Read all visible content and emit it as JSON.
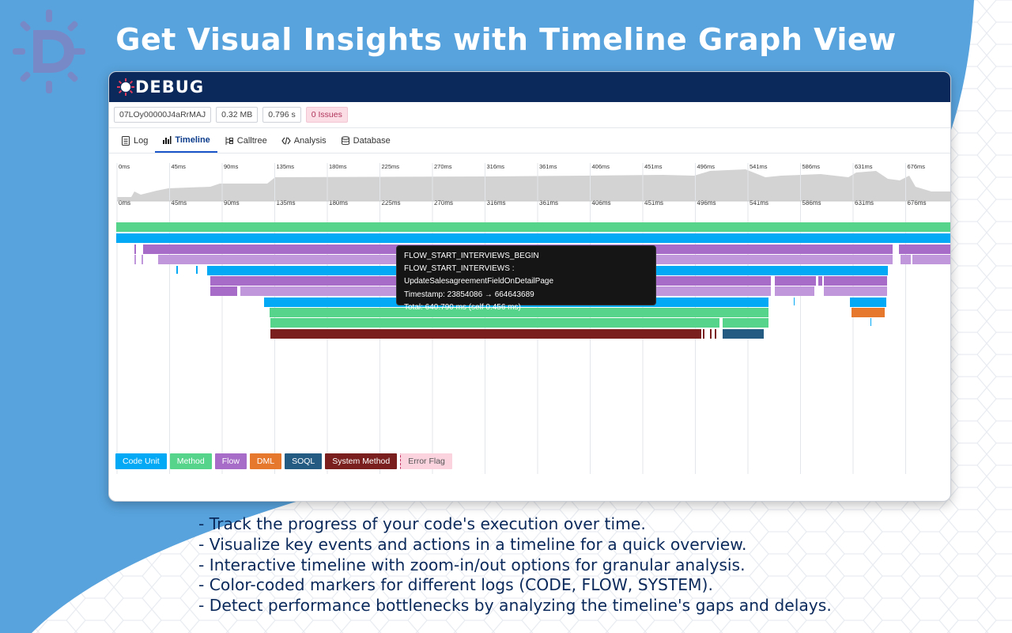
{
  "headline": "Get Visual Insights with Timeline Graph View",
  "brand": {
    "name": "DEBUG"
  },
  "info": {
    "log_id": "07LOy00000J4aRrMAJ",
    "size": "0.32 MB",
    "duration": "0.796 s",
    "issues": "0 Issues"
  },
  "tabs": [
    {
      "label": "Log",
      "icon": "log-icon",
      "active": false
    },
    {
      "label": "Timeline",
      "icon": "bar-chart-icon",
      "active": true
    },
    {
      "label": "Calltree",
      "icon": "calltree-icon",
      "active": false
    },
    {
      "label": "Analysis",
      "icon": "code-icon",
      "active": false
    },
    {
      "label": "Database",
      "icon": "database-icon",
      "active": false
    }
  ],
  "timeline": {
    "ticks": [
      "0ms",
      "45ms",
      "90ms",
      "135ms",
      "180ms",
      "225ms",
      "270ms",
      "316ms",
      "361ms",
      "406ms",
      "451ms",
      "496ms",
      "541ms",
      "586ms",
      "631ms",
      "676ms"
    ],
    "colors": {
      "code_unit": "#03a9f4",
      "method": "#56d48c",
      "flow": "#a66cc8",
      "flow_light": "#c197dc",
      "dml": "#e6782e",
      "soql": "#245b83",
      "system_method": "#7a1f1d",
      "error_flag": "#fad3df"
    }
  },
  "tooltip": {
    "event": "FLOW_START_INTERVIEWS_BEGIN",
    "detail": "FLOW_START_INTERVIEWS : UpdateSalesagreementFieldOnDetailPage",
    "timestamp": "Timestamp: 23854086 → 664643689",
    "total": "Total: 640.790 ms (self 0.456 ms)"
  },
  "legend": [
    {
      "label": "Code Unit",
      "color": "#03a9f4",
      "text_color": "#ffffff"
    },
    {
      "label": "Method",
      "color": "#56d48c",
      "text_color": "#ffffff"
    },
    {
      "label": "Flow",
      "color": "#a66cc8",
      "text_color": "#ffffff"
    },
    {
      "label": "DML",
      "color": "#e6782e",
      "text_color": "#ffffff"
    },
    {
      "label": "SOQL",
      "color": "#245b83",
      "text_color": "#ffffff"
    },
    {
      "label": "System Method",
      "color": "#7a1f1d",
      "text_color": "#ffffff"
    },
    {
      "label": "Error Flag",
      "color": "#fad3df",
      "text_color": "#555555"
    }
  ],
  "bullets": [
    "- Track the progress of your code's execution over time.",
    "- Visualize key events and actions in a timeline for a quick overview.",
    "- Interactive timeline with zoom-in/out options for granular analysis.",
    "- Color-coded markers for different logs (CODE, FLOW, SYSTEM).",
    "- Detect performance bottlenecks by analyzing the timeline's gaps and delays."
  ]
}
